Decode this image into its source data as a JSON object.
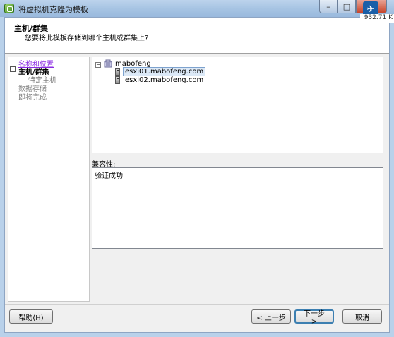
{
  "window": {
    "title": "将虚拟机克隆为模板"
  },
  "tray": {
    "text": "932.71 K"
  },
  "header": {
    "title": "主机/群集",
    "subtitle": "您要将此模板存储到哪个主机或群集上?"
  },
  "nav": {
    "items": [
      {
        "label": "名称和位置",
        "state": "link"
      },
      {
        "label": "主机/群集",
        "state": "active",
        "expander": "⊟"
      },
      {
        "label": "特定主机",
        "state": "sub"
      },
      {
        "label": "数据存储",
        "state": "pending"
      },
      {
        "label": "即将完成",
        "state": "pending"
      }
    ]
  },
  "tree": {
    "datacenter": {
      "label": "mabofeng",
      "expander": "⊟",
      "icon": "datacenter-icon"
    },
    "hosts": [
      {
        "label": "esxi01.mabofeng.com",
        "selected": true,
        "icon": "host-icon"
      },
      {
        "label": "esxi02.mabofeng.com",
        "selected": false,
        "icon": "host-icon"
      }
    ]
  },
  "compatibility": {
    "label": "兼容性:",
    "message": "验证成功"
  },
  "buttons": {
    "help": "帮助(H)",
    "back": "< 上一步",
    "next": "下一步 >",
    "cancel": "取消"
  },
  "colors": {
    "link": "#8a2be2",
    "selection_bg": "#dce9f7",
    "selection_border": "#7da2ce",
    "default_button_border": "#3c7fb1"
  }
}
